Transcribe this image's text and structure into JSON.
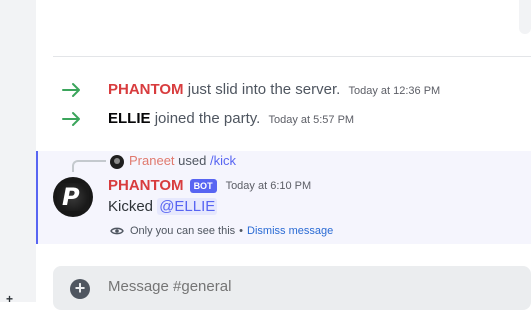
{
  "system_messages": [
    {
      "arrow_icon": "join-arrow-icon",
      "name": "PHANTOM",
      "text": "just slid into the server.",
      "timestamp": "Today at 12:36 PM"
    },
    {
      "arrow_icon": "join-arrow-icon",
      "name": "ELLIE",
      "text": "joined the party.",
      "timestamp": "Today at 5:57 PM"
    }
  ],
  "ephemeral": {
    "reply": {
      "user": "Praneet",
      "verb": "used",
      "command": "/kick"
    },
    "author": "PHANTOM",
    "badge": "BOT",
    "timestamp": "Today at 6:10 PM",
    "body_prefix": "Kicked",
    "mention": "@ELLIE",
    "note": "Only you can see this",
    "separator": "•",
    "dismiss_label": "Dismiss message",
    "avatar_letter": "P"
  },
  "composer": {
    "placeholder": "Message #general"
  },
  "left_strip": {
    "glyph": "+"
  },
  "colors": {
    "accent": "#5865f2",
    "join_green": "#3ba55c",
    "name_red": "#d83c3e"
  }
}
